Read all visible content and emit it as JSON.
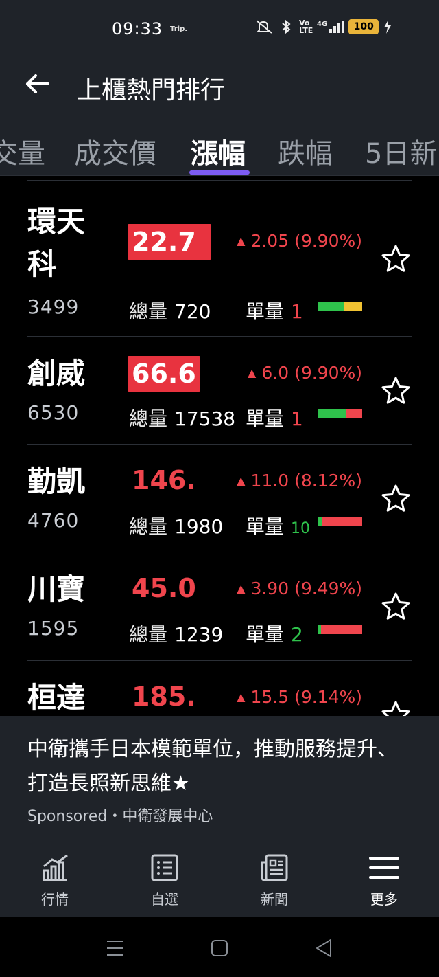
{
  "status_bar": {
    "time": "09:33",
    "trip": "Trip.",
    "icons": [
      "mute-icon",
      "bluetooth-icon",
      "volte-icon",
      "signal-4g-icon"
    ],
    "battery": "100"
  },
  "header": {
    "title": "上櫃熱門排行"
  },
  "tabs": [
    {
      "label": "交量"
    },
    {
      "label": "成交價"
    },
    {
      "label": "漲幅"
    },
    {
      "label": "跌幅"
    },
    {
      "label": "5日新"
    }
  ],
  "active_tab": "漲幅",
  "list": {
    "vol_label": "總量",
    "single_label": "單量",
    "rows": [
      {
        "name": "環天\n科",
        "code": "3499",
        "price": "22.7",
        "change": "2.05 (9.90%)",
        "volume": "720",
        "single": "1",
        "bar": [
          {
            "pct": 0.6,
            "color": "#2fc24c"
          },
          {
            "pct": 0.4,
            "color": "#f1c232"
          }
        ]
      },
      {
        "name": "創威",
        "code": "6530",
        "price": "66.6",
        "change": "6.0 (9.90%)",
        "volume": "17538",
        "single": "1",
        "bar": [
          {
            "pct": 0.62,
            "color": "#2fc24c"
          },
          {
            "pct": 0.38,
            "color": "#f0454d"
          }
        ]
      },
      {
        "name": "勤凱",
        "code": "4760",
        "price": "146.",
        "change": "11.0 (8.12%)",
        "volume": "1980",
        "single": "10",
        "bar": [
          {
            "pct": 0.08,
            "color": "#2fc24c"
          },
          {
            "pct": 0.92,
            "color": "#f0454d"
          }
        ]
      },
      {
        "name": "川寶",
        "code": "1595",
        "price": "45.0",
        "change": "3.90 (9.49%)",
        "volume": "1239",
        "single": "2",
        "bar": [
          {
            "pct": 0.06,
            "color": "#2fc24c"
          },
          {
            "pct": 0.94,
            "color": "#f0454d"
          }
        ]
      },
      {
        "name": "桓達",
        "code": "",
        "price": "185.",
        "change": "15.5 (9.14%)",
        "volume": "",
        "single": "",
        "bar": []
      }
    ]
  },
  "ad": {
    "title": "中衛攜手日本模範單位，推動服務提升、打造長照新思維★",
    "source": "Sponsored・中衛發展中心"
  },
  "bottom_nav": [
    {
      "label": "行情",
      "icon": "chart-icon"
    },
    {
      "label": "自選",
      "icon": "list-icon"
    },
    {
      "label": "新聞",
      "icon": "news-icon"
    },
    {
      "label": "更多",
      "icon": "menu-icon"
    }
  ],
  "colors": {
    "up": "#f0454d",
    "accent": "#7d5cf2",
    "panel": "#1f2329",
    "background": "#000000"
  }
}
